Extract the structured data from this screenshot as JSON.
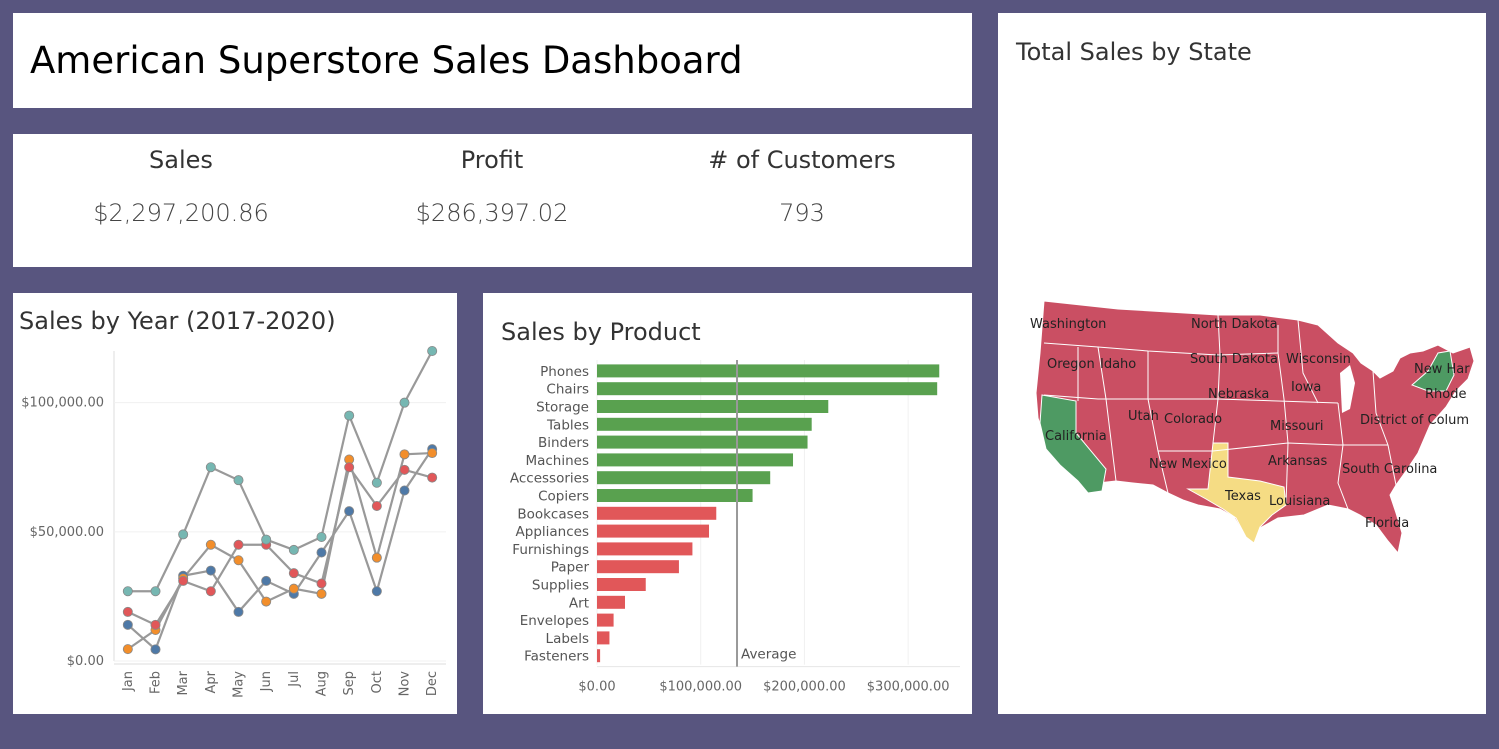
{
  "title": "American Superstore Sales Dashboard",
  "kpis": [
    {
      "label": "Sales",
      "value": "$2,297,200.86"
    },
    {
      "label": "Profit",
      "value": "$286,397.02"
    },
    {
      "label": "# of Customers",
      "value": "793"
    }
  ],
  "colors": {
    "background": "#58557f",
    "bar_above": "#59a14f",
    "bar_below": "#e15759",
    "line": "#999999",
    "map_high": "#4e9a63",
    "map_mid": "#f5dc84",
    "map_low": "#ca4f63"
  },
  "chart_data": [
    {
      "type": "line",
      "title": "Sales by Year (2017-2020)",
      "categories": [
        "Jan",
        "Feb",
        "Mar",
        "Apr",
        "May",
        "Jun",
        "Jul",
        "Aug",
        "Sep",
        "Oct",
        "Nov",
        "Dec"
      ],
      "ylim": [
        0,
        120000
      ],
      "yticks": [
        0,
        50000,
        100000
      ],
      "ytick_labels": [
        "$0.00",
        "$50,000.00",
        "$100,000.00"
      ],
      "series": [
        {
          "color": "#4e79a7",
          "values": [
            14000,
            4500,
            33000,
            35000,
            19000,
            31000,
            26000,
            42000,
            58000,
            27000,
            66000,
            82000
          ]
        },
        {
          "color": "#f28e2b",
          "values": [
            4600,
            12000,
            32000,
            45000,
            39000,
            23000,
            28000,
            26000,
            78000,
            40000,
            80000,
            80500
          ]
        },
        {
          "color": "#e15759",
          "values": [
            19000,
            14000,
            31000,
            27000,
            45000,
            45000,
            34000,
            30000,
            75000,
            60000,
            74000,
            71000
          ]
        },
        {
          "color": "#76b7b2",
          "values": [
            27000,
            27000,
            49000,
            75000,
            70000,
            47000,
            43000,
            48000,
            95000,
            69000,
            100000,
            120000
          ]
        }
      ]
    },
    {
      "type": "bar",
      "orientation": "horizontal",
      "title": "Sales by Product",
      "categories": [
        "Phones",
        "Chairs",
        "Storage",
        "Tables",
        "Binders",
        "Machines",
        "Accessories",
        "Copiers",
        "Bookcases",
        "Appliances",
        "Furnishings",
        "Paper",
        "Supplies",
        "Art",
        "Envelopes",
        "Labels",
        "Fasteners"
      ],
      "values": [
        330000,
        328000,
        223000,
        207000,
        203000,
        189000,
        167000,
        150000,
        115000,
        108000,
        92000,
        79000,
        47000,
        27000,
        16000,
        12000,
        3000
      ],
      "xlim": [
        0,
        350000
      ],
      "xticks": [
        0,
        100000,
        200000,
        300000
      ],
      "xtick_labels": [
        "$0.00",
        "$100,000.00",
        "$200,000.00",
        "$300,000.00"
      ],
      "average": 135000,
      "average_label": "Average"
    },
    {
      "type": "map",
      "title": "Total Sales by State",
      "state_labels": [
        "Washington",
        "North Dakota",
        "Oregon",
        "Idaho",
        "South Dakota",
        "Wisconsin",
        "New Har",
        "Nebraska",
        "Iowa",
        "Rhode",
        "Utah",
        "Colorado",
        "District of Colum",
        "California",
        "Missouri",
        "New Mexico",
        "Arkansas",
        "South Carolina",
        "Texas",
        "Louisiana",
        "Florida"
      ],
      "highlighted": {
        "California": "high",
        "New York": "high",
        "Texas": "mid"
      }
    }
  ]
}
